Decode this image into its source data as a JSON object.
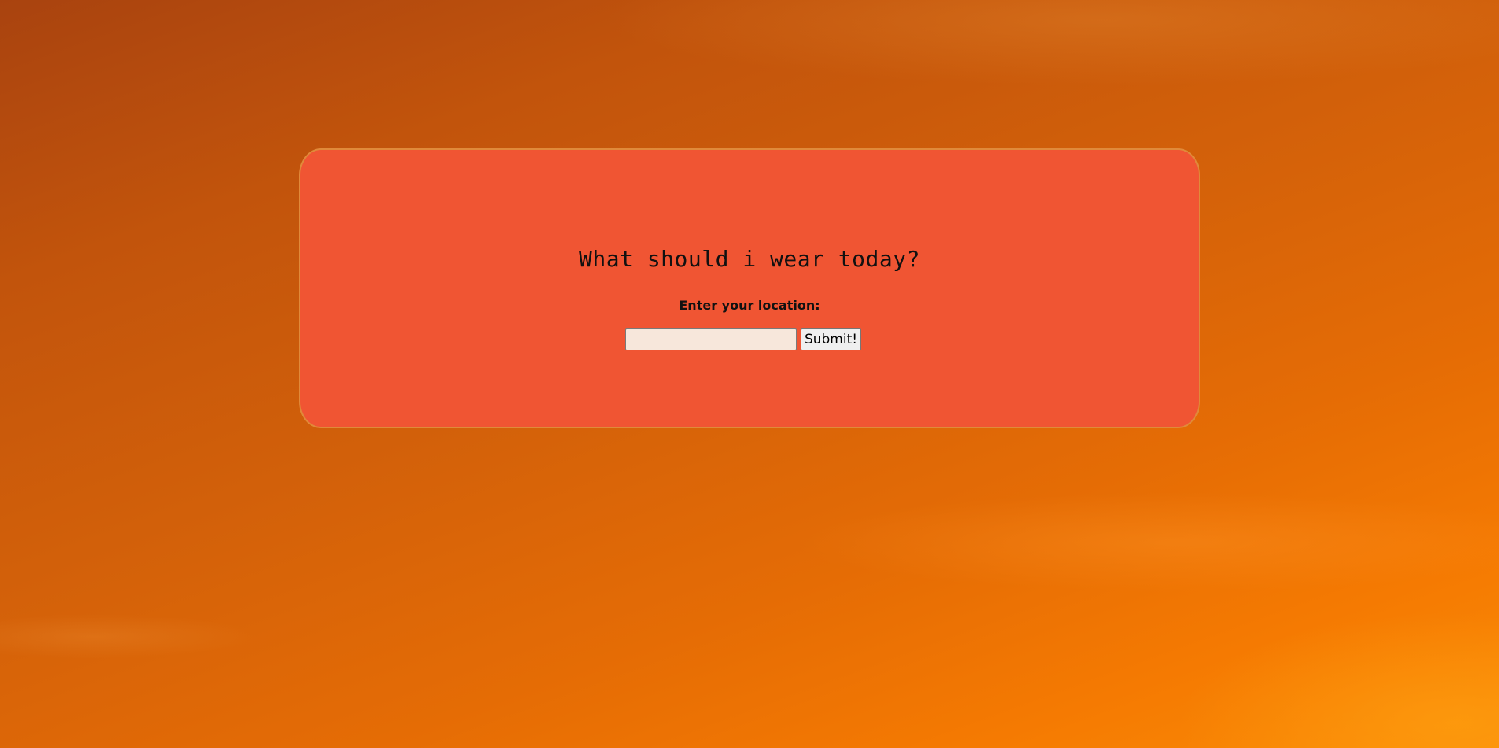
{
  "main": {
    "title": "What should i wear today?",
    "location_label": "Enter your location:",
    "location_input": {
      "value": "",
      "placeholder": ""
    },
    "submit_label": "Submit!"
  },
  "colors": {
    "card_background": "#f05533",
    "card_border": "#e08a3a",
    "input_background": "#f7e7db",
    "background_sky": "#d2600a"
  }
}
